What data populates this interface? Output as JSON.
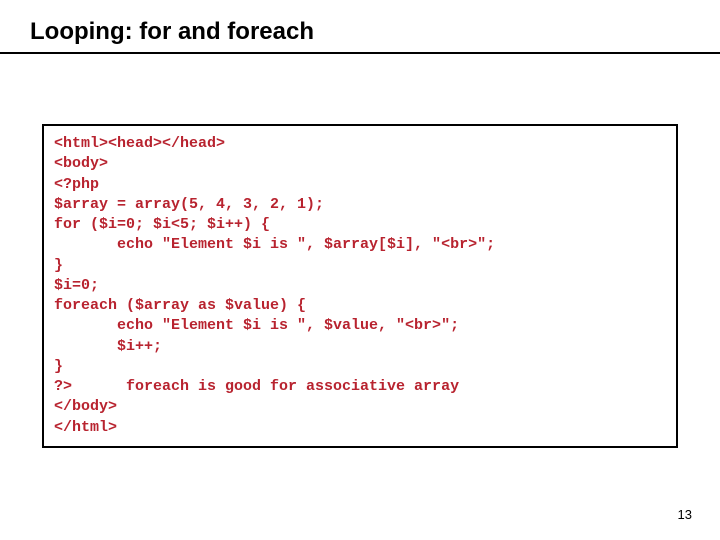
{
  "title": "Looping: for and foreach",
  "code": {
    "l1": "<html><head></head>",
    "l2": "<body>",
    "l3": "<?php",
    "l4": "$array = array(5, 4, 3, 2, 1);",
    "l5": "for ($i=0; $i<5; $i++) {",
    "l6": "       echo \"Element $i is \", $array[$i], \"<br>\";",
    "l7": "}",
    "l8": "$i=0;",
    "l9": "foreach ($array as $value) {",
    "l10": "       echo \"Element $i is \", $value, \"<br>\";",
    "l11": "       $i++;",
    "l12": "}",
    "l13": "?>      foreach is good for associative array",
    "l14": "</body>",
    "l15": "</html>"
  },
  "pageNumber": "13"
}
